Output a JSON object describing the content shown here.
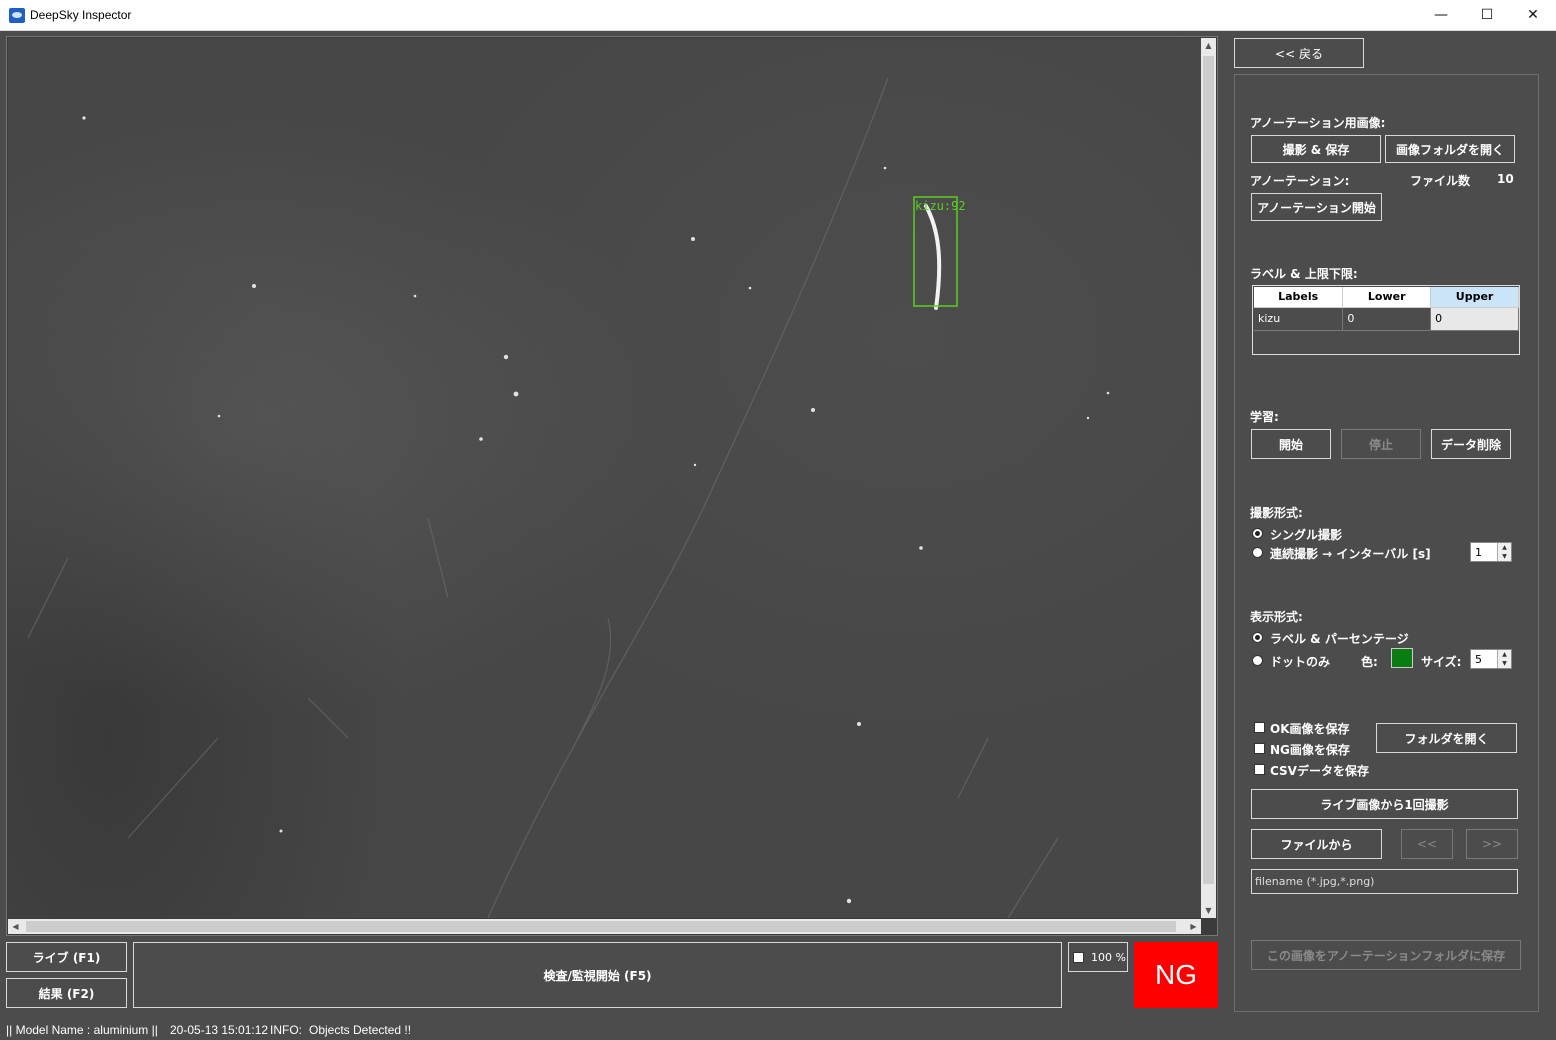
{
  "window": {
    "title": "DeepSky Inspector",
    "minimize": "—",
    "maximize": "☐",
    "close": "✕"
  },
  "viewer": {
    "detection_label": "kizu:92"
  },
  "bottom": {
    "live_button": "ライブ (F1)",
    "result_button": "結果 (F2)",
    "start_button": "検査/監視開始 (F5)",
    "percent_label": "100 %",
    "judgement": "NG"
  },
  "panel": {
    "back_button": "<< 戻る",
    "annotation_image_label": "アノーテーション用画像:",
    "capture_save_button": "撮影 & 保存",
    "open_image_folder_button": "画像フォルダを開く",
    "annotation_label": "アノーテーション:",
    "file_count_label": "ファイル数",
    "file_count_value": "10",
    "annotation_start_button": "アノーテーション開始",
    "label_limits_label": "ラベル & 上限下限:",
    "table": {
      "headers": [
        "Labels",
        "Lower",
        "Upper"
      ],
      "rows": [
        [
          "kizu",
          "0",
          "0"
        ]
      ]
    },
    "learning_label": "学習:",
    "learn_start_button": "開始",
    "learn_stop_button": "停止",
    "data_delete_button": "データ削除",
    "capture_mode_label": "撮影形式:",
    "single_capture": "シングル撮影",
    "continuous_capture": "連続撮影 → インターバル [s]",
    "interval_value": "1",
    "display_mode_label": "表示形式:",
    "label_percentage": "ラベル & パーセンテージ",
    "dot_only": "ドットのみ",
    "color_label": "色:",
    "size_label": "サイズ:",
    "size_value": "5",
    "dot_color": "#0a7d12",
    "save_ok": "OK画像を保存",
    "save_ng": "NG画像を保存",
    "save_csv": "CSVデータを保存",
    "open_folder_button": "フォルダを開く",
    "capture_once_button": "ライブ画像から1回撮影",
    "from_file_button": "ファイルから",
    "prev_button": "<<",
    "next_button": ">>",
    "filename_placeholder": "filename (*.jpg,*.png)",
    "save_to_annotation_button": "この画像をアノーテーションフォルダに保存"
  },
  "status": {
    "model": "|| Model Name : aluminium ||",
    "timestamp": "20-05-13 15:01:12",
    "info_label": "INFO:",
    "info_text": "Objects Detected !!"
  }
}
